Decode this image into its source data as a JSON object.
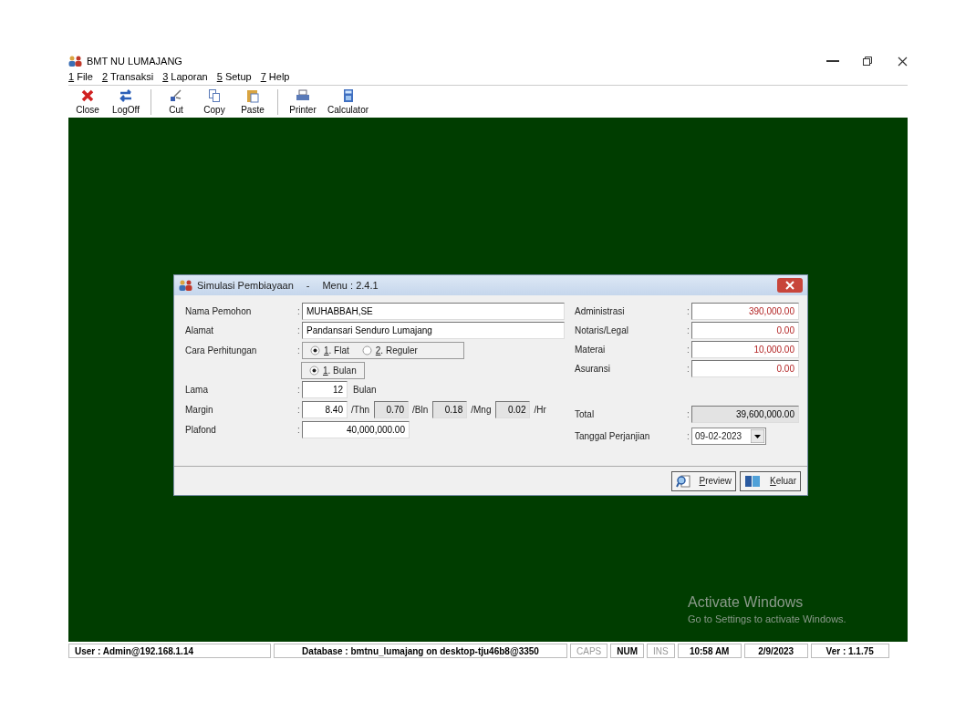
{
  "window": {
    "title": "BMT NU LUMAJANG"
  },
  "menu": [
    {
      "key": "1",
      "label": " File"
    },
    {
      "key": "2",
      "label": " Transaksi"
    },
    {
      "key": "3",
      "label": " Laporan"
    },
    {
      "key": "5",
      "label": " Setup"
    },
    {
      "key": "7",
      "label": " Help"
    }
  ],
  "toolbar": [
    {
      "kind": "close",
      "label": "Close"
    },
    {
      "kind": "logoff",
      "label": "LogOff"
    },
    {
      "kind": "separator"
    },
    {
      "kind": "cut",
      "label": "Cut"
    },
    {
      "kind": "copy",
      "label": "Copy"
    },
    {
      "kind": "paste",
      "label": "Paste"
    },
    {
      "kind": "separator"
    },
    {
      "kind": "printer",
      "label": "Printer"
    },
    {
      "kind": "calculator",
      "label": "Calculator"
    }
  ],
  "dialog": {
    "title": "Simulasi Pembiayaan",
    "separator": "-",
    "menu_code": "Menu : 2.4.1",
    "nama": {
      "label": "Nama Pemohon",
      "colon": ":",
      "value": "MUHABBAH,SE"
    },
    "alamat": {
      "label": "Alamat",
      "colon": ":",
      "value": "Pandansari Senduro Lumajang"
    },
    "cara": {
      "label": "Cara Perhitungan",
      "colon": ":",
      "options": [
        {
          "key": "1",
          "label": ". Flat",
          "selected": true
        },
        {
          "key": "2",
          "label": ". Reguler",
          "selected": false
        }
      ],
      "period": [
        {
          "key": "1",
          "label": ". Bulan",
          "selected": true
        }
      ]
    },
    "lama": {
      "label": "Lama",
      "colon": ":",
      "value": "12",
      "unit": "Bulan"
    },
    "margin": {
      "label": "Margin",
      "colon": ":",
      "parts": [
        {
          "value": "8.40",
          "unit": "/Thn",
          "disabled": false
        },
        {
          "value": "0.70",
          "unit": "/Bln",
          "disabled": true
        },
        {
          "value": "0.18",
          "unit": "/Mng",
          "disabled": true
        },
        {
          "value": "0.02",
          "unit": "/Hr",
          "disabled": true
        }
      ]
    },
    "plafond": {
      "label": "Plafond",
      "colon": ":",
      "value": "40,000,000.00"
    },
    "costs": [
      {
        "label": "Administrasi",
        "colon": ":",
        "value": "390,000.00"
      },
      {
        "label": "Notaris/Legal",
        "colon": ":",
        "value": "0.00"
      },
      {
        "label": "Materai",
        "colon": ":",
        "value": "10,000.00"
      },
      {
        "label": "Asuransi",
        "colon": ":",
        "value": "0.00"
      }
    ],
    "total": {
      "label": "Total",
      "colon": ":",
      "value": "39,600,000.00"
    },
    "tanggal": {
      "label": "Tanggal Perjanjian",
      "colon": ":",
      "value": "09-02-2023"
    },
    "buttons": [
      {
        "kind": "preview",
        "key": "P",
        "label": "review"
      },
      {
        "kind": "exit",
        "key": "K",
        "label": "eluar"
      }
    ]
  },
  "activation": {
    "title": "Activate Windows",
    "subtitle": "Go to Settings to activate Windows."
  },
  "status_bar": [
    {
      "text": "User : Admin@192.168.1.14",
      "on": true
    },
    {
      "text": "Database : bmtnu_lumajang on desktop-tju46b8@3350",
      "on": true
    },
    {
      "text": "CAPS",
      "on": false
    },
    {
      "text": "NUM",
      "on": true
    },
    {
      "text": "INS",
      "on": false
    },
    {
      "text": "10:58 AM",
      "on": true
    },
    {
      "text": "2/9/2023",
      "on": true
    },
    {
      "text": "Ver : 1.1.75",
      "on": true
    }
  ]
}
